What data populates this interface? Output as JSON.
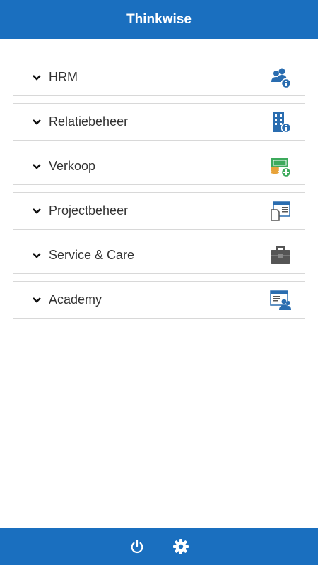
{
  "header": {
    "title": "Thinkwise"
  },
  "menu": {
    "groups": [
      {
        "label": "HRM",
        "icon": "hr-users-info-icon"
      },
      {
        "label": "Relatiebeheer",
        "icon": "building-info-icon"
      },
      {
        "label": "Verkoop",
        "icon": "money-add-icon"
      },
      {
        "label": "Projectbeheer",
        "icon": "project-document-icon"
      },
      {
        "label": "Service & Care",
        "icon": "toolbox-icon"
      },
      {
        "label": "Academy",
        "icon": "academy-presentation-icon"
      }
    ]
  },
  "footer": {
    "icons": [
      "power-icon",
      "gear-icon"
    ]
  },
  "colors": {
    "brand": "#1a6fbf",
    "icon_blue": "#2a6db0",
    "money_green": "#3daa5c",
    "coin_orange": "#e8a33a",
    "toolbox_gray": "#555555"
  }
}
